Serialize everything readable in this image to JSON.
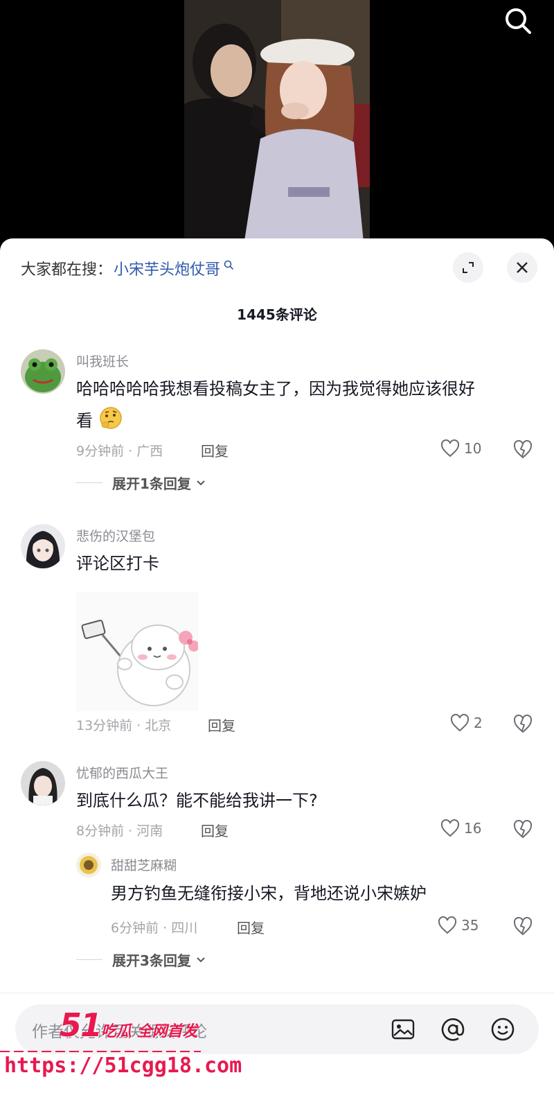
{
  "video": {
    "search_icon": "search-icon"
  },
  "sheet": {
    "search_prefix": "大家都在搜：",
    "search_term": "小宋芋头炮仗哥",
    "expand_icon": "expand-icon",
    "close_icon": "close-icon",
    "comment_count": "1445条评论"
  },
  "comments": [
    {
      "name": "叫我班长",
      "text_line1": "哈哈哈哈哈我想看投稿女主了，因为我觉得她应该很好",
      "text_line2": "看",
      "emoji": "thinking-face-icon",
      "time_location": "9分钟前 · 广西",
      "reply": "回复",
      "likes": "10",
      "expand": "展开1条回复"
    },
    {
      "name": "悲伤的汉堡包",
      "text": "评论区打卡",
      "sticker": "selfie-bun-sticker",
      "time_location": "13分钟前 · 北京",
      "reply": "回复",
      "likes": "2"
    },
    {
      "name": "忧郁的西瓜大王",
      "text": "到底什么瓜？能不能给我讲一下?",
      "time_location": "8分钟前 · 河南",
      "reply": "回复",
      "likes": "16",
      "sub_reply": {
        "name": "甜甜芝麻糊",
        "text": "男方钓鱼无缝衔接小宋，背地还说小宋嫉妒",
        "time_location": "6分钟前 · 四川",
        "reply": "回复",
        "likes": "35"
      },
      "expand": "展开3条回复"
    }
  ],
  "bottom_bar": {
    "placeholder": "作者仅允许互关朋友评论",
    "icons": [
      "image-icon",
      "at-icon",
      "emoji-icon"
    ]
  },
  "watermark": {
    "logo": "51",
    "slogan": "吃瓜 全网首发",
    "url": "https://51cgg18.com"
  },
  "colors": {
    "accent_link": "#2f5aa8",
    "watermark": "#e8194f"
  }
}
